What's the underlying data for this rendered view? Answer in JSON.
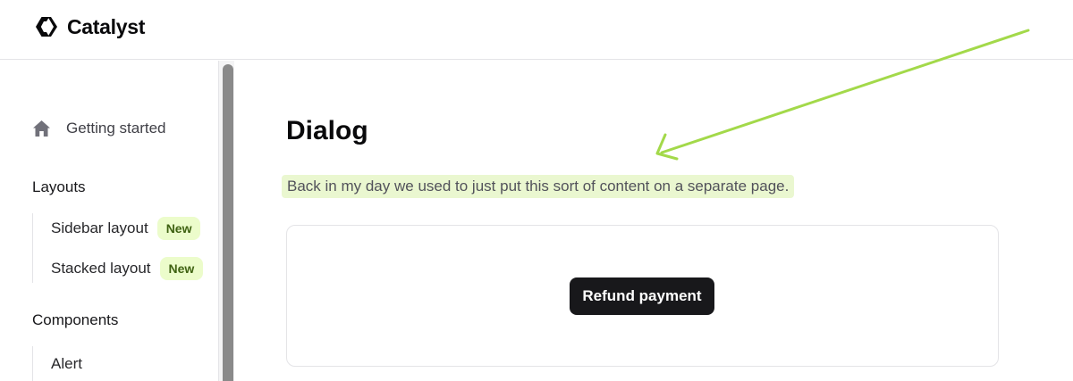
{
  "app": {
    "name": "Catalyst"
  },
  "sidebar": {
    "home_label": "Getting started",
    "sections": [
      {
        "title": "Layouts",
        "items": [
          {
            "label": "Sidebar layout",
            "badge": "New"
          },
          {
            "label": "Stacked layout",
            "badge": "New"
          }
        ]
      },
      {
        "title": "Components",
        "items": [
          {
            "label": "Alert"
          }
        ]
      }
    ]
  },
  "main": {
    "title": "Dialog",
    "lede": "Back in my day we used to just put this sort of content on a separate page.",
    "demo_button_label": "Refund payment"
  },
  "colors": {
    "accent_highlight": "#eaf7d0",
    "badge_bg": "#ecfccb",
    "badge_text": "#3f6212",
    "annotation_arrow": "#a3d94a",
    "button_bg": "#18181b"
  }
}
